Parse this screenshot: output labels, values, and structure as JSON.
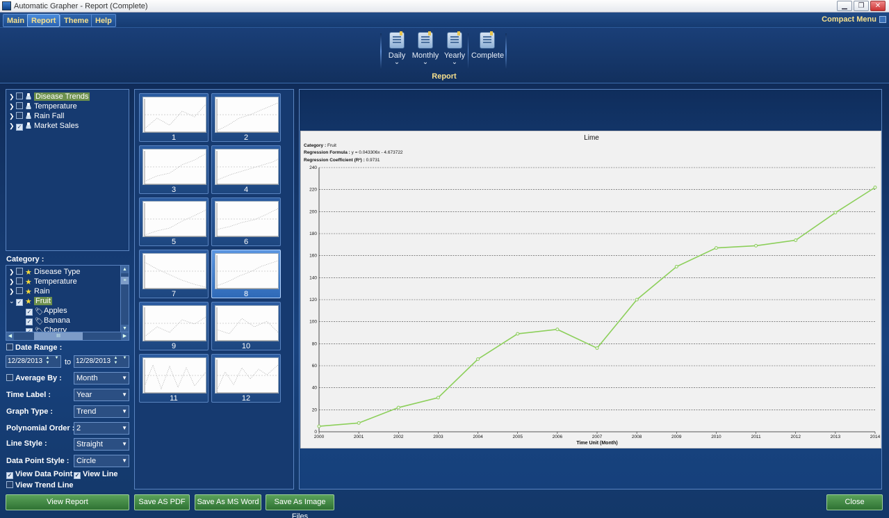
{
  "window": {
    "title": "Automatic Grapher - Report (Complete)",
    "buttons": [
      "▁",
      "❐",
      "✕"
    ]
  },
  "menu": {
    "items": [
      "Main",
      "Report",
      "Theme",
      "Help"
    ],
    "active": "Report",
    "compact": "Compact Menu"
  },
  "ribbon": {
    "buttons": [
      {
        "label": "Daily",
        "dropdown": true
      },
      {
        "label": "Monthly",
        "dropdown": true
      },
      {
        "label": "Yearly",
        "dropdown": true
      },
      {
        "label": "Complete",
        "dropdown": false
      }
    ],
    "group_label": "Report"
  },
  "datasets": [
    {
      "label": "Disease Trends",
      "checked": false,
      "highlighted": true
    },
    {
      "label": "Temperature",
      "checked": false
    },
    {
      "label": "Rain Fall",
      "checked": false
    },
    {
      "label": "Market Sales",
      "checked": true
    }
  ],
  "category": {
    "label": "Category :",
    "items": [
      {
        "label": "Disease Type",
        "checked": false,
        "expand": "›"
      },
      {
        "label": "Temperature",
        "checked": false,
        "expand": "›"
      },
      {
        "label": "Rain",
        "checked": false,
        "expand": "›"
      },
      {
        "label": "Fruit",
        "checked": true,
        "expand": "⌄",
        "highlighted": true
      },
      {
        "label": "Apples",
        "checked": true,
        "child": true
      },
      {
        "label": "Banana",
        "checked": true,
        "child": true
      },
      {
        "label": "Cherry",
        "checked": true,
        "child": true
      }
    ],
    "hscroll_thumb": "III"
  },
  "options": {
    "date_range": {
      "label": "Date Range :",
      "checked": false,
      "from": "12/28/2013",
      "to_label": "to",
      "to": "12/28/2013"
    },
    "average_by": {
      "label": "Average By :",
      "checked": false,
      "value": "Month"
    },
    "time_label": {
      "label": "Time Label :",
      "value": "Year"
    },
    "graph_type": {
      "label": "Graph Type :",
      "value": "Trend"
    },
    "polynomial_order": {
      "label": "Polynomial Order :",
      "value": "2"
    },
    "line_style": {
      "label": "Line Style :",
      "value": "Straight"
    },
    "data_point_style": {
      "label": "Data Point Style :",
      "value": "Circle"
    },
    "view_data_point": {
      "label": "View Data Point",
      "checked": true
    },
    "view_line": {
      "label": "View Line",
      "checked": true
    },
    "view_trend_line": {
      "label": "View Trend Line",
      "checked": false
    }
  },
  "thumbnails": [
    {
      "number": "1"
    },
    {
      "number": "2"
    },
    {
      "number": "3"
    },
    {
      "number": "4"
    },
    {
      "number": "5"
    },
    {
      "number": "6"
    },
    {
      "number": "7"
    },
    {
      "number": "8",
      "selected": true
    },
    {
      "number": "9"
    },
    {
      "number": "10"
    },
    {
      "number": "11"
    },
    {
      "number": "12"
    }
  ],
  "chart_data": {
    "type": "line",
    "title": "Lime",
    "info": [
      {
        "label": "Category :",
        "value": "Fruit"
      },
      {
        "label": "Regression Formula :",
        "value": "y = 0.043306x - 4.673722"
      },
      {
        "label": "Regression Coefficient (R²) :",
        "value": "0.9731"
      }
    ],
    "xlabel": "Time Unit (Month)",
    "ylabel": "",
    "x": [
      "2000",
      "2001",
      "2002",
      "2003",
      "2004",
      "2005",
      "2006",
      "2007",
      "2008",
      "2009",
      "2010",
      "2011",
      "2012",
      "2013",
      "2014"
    ],
    "values": [
      5,
      8,
      22,
      31,
      66,
      89,
      93,
      76,
      120,
      150,
      167,
      169,
      174,
      199,
      222
    ],
    "ylim": [
      0,
      240
    ],
    "yticks": [
      0,
      20,
      40,
      60,
      80,
      100,
      120,
      140,
      160,
      180,
      200,
      220,
      240
    ],
    "grid": true,
    "line_color": "#8ccf5a"
  },
  "actions": {
    "view_report": "View Report",
    "save_pdf": "Save AS PDF",
    "save_word": "Save As MS Word",
    "save_image": "Save As Image Files",
    "close": "Close"
  },
  "colors": {
    "background": "#0f2a55",
    "accent_text": "#f7e08d",
    "button_green": "#3f8a42"
  }
}
